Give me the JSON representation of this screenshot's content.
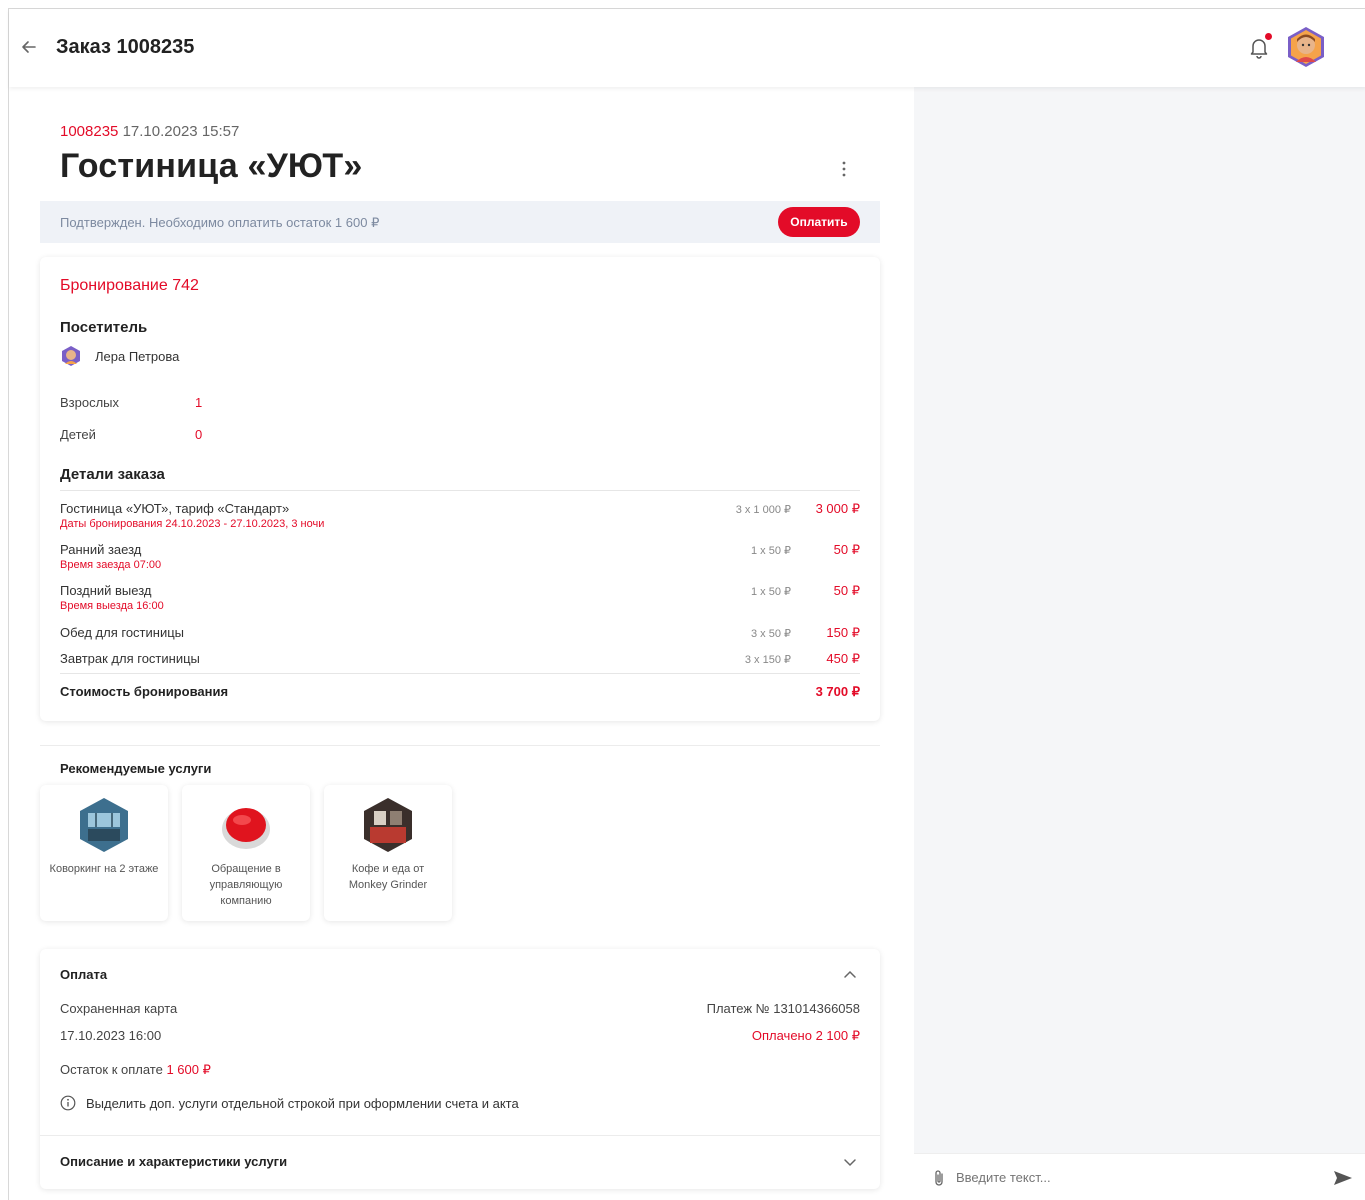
{
  "header": {
    "title": "Заказ 1008235"
  },
  "order": {
    "number": "1008235",
    "datetime": "17.10.2023 15:57",
    "hotel_title": "Гостиница «УЮТ»"
  },
  "status": {
    "text": "Подтвержден. Необходимо оплатить остаток 1 600 ₽",
    "pay_button": "Оплатить"
  },
  "booking": {
    "title": "Бронирование 742",
    "visitor_heading": "Посетитель",
    "visitor_name": "Лера Петрова",
    "adults_label": "Взрослых",
    "adults_value": "1",
    "children_label": "Детей",
    "children_value": "0",
    "details_heading": "Детали заказа",
    "lines": [
      {
        "name": "Гостиница «УЮТ», тариф «Стандарт»",
        "sub": "Даты бронирования 24.10.2023 - 27.10.2023, 3 ночи",
        "qty": "3 x 1 000 ₽",
        "sum": "3 000 ₽"
      },
      {
        "name": "Ранний заезд",
        "sub": "Время заезда 07:00",
        "qty": "1 x 50 ₽",
        "sum": "50 ₽"
      },
      {
        "name": "Поздний выезд",
        "sub": "Время выезда 16:00",
        "qty": "1 x 50 ₽",
        "sum": "50 ₽"
      },
      {
        "name": "Обед для гостиницы",
        "sub": "",
        "qty": "3 x 50 ₽",
        "sum": "150 ₽"
      },
      {
        "name": "Завтрак для гостиницы",
        "sub": "",
        "qty": "3 x 150 ₽",
        "sum": "450 ₽"
      }
    ],
    "total_label": "Стоимость бронирования",
    "total_value": "3 700 ₽"
  },
  "recommended": {
    "title": "Рекомендуемые услуги",
    "items": [
      {
        "label": "Коворкинг на 2 этаже"
      },
      {
        "label": "Обращение в управляющую компанию"
      },
      {
        "label": "Кофе и еда от Monkey Grinder"
      }
    ]
  },
  "payment": {
    "title": "Оплата",
    "method": "Сохраненная карта",
    "date": "17.10.2023 16:00",
    "payment_no": "Платеж № 131014366058",
    "paid": "Оплачено 2 100 ₽",
    "remain_label": "Остаток к оплате",
    "remain_value": "1 600 ₽",
    "info_text": "Выделить доп. услуги отдельной строкой при оформлении счета и акта",
    "description_title": "Описание и характеристики услуги"
  },
  "chat": {
    "placeholder": "Введите текст..."
  },
  "colors": {
    "accent": "#e30b28",
    "status_bg": "#eff2f7",
    "right_pane_bg": "#f5f6f8"
  }
}
